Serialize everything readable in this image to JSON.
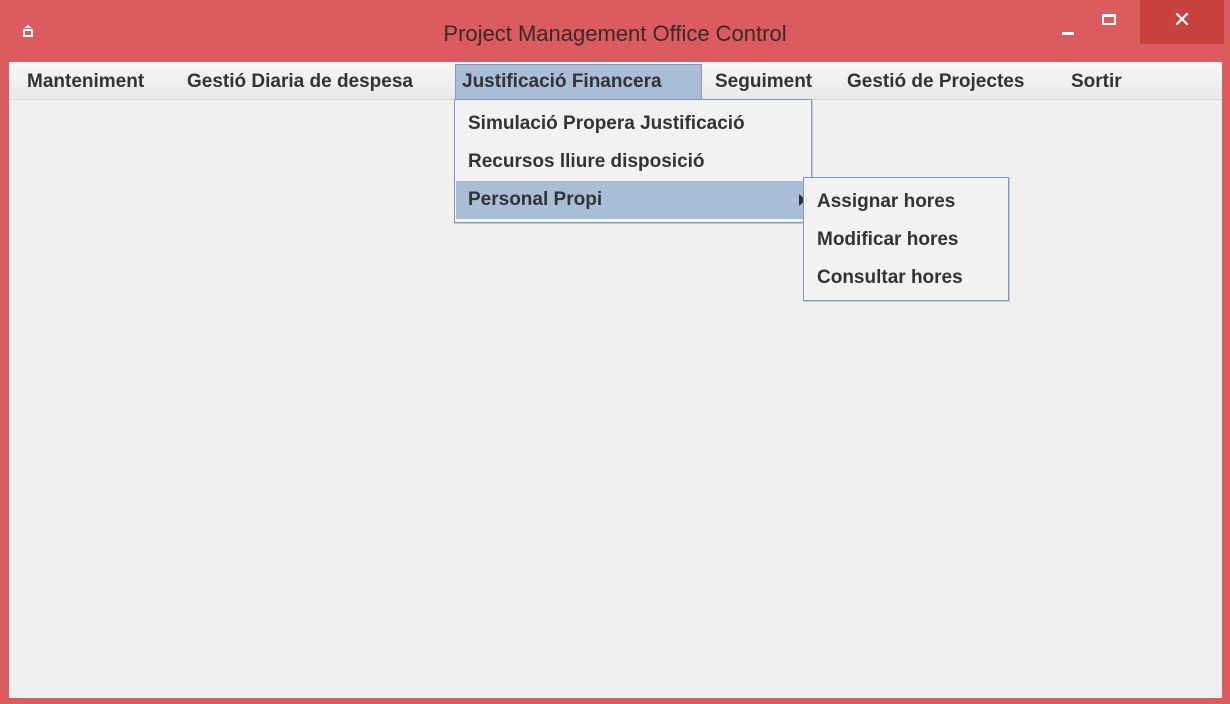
{
  "window": {
    "title": "Project Management Office Control",
    "icon": "java-cup-icon",
    "minimize_icon": "minimize-icon",
    "maximize_icon": "maximize-icon",
    "close_icon": "close-icon",
    "close_glyph": "✕"
  },
  "menubar": {
    "items": [
      {
        "label": "Manteniment"
      },
      {
        "label": "Gestió Diaria de despesa"
      },
      {
        "label": "Justificació Financera"
      },
      {
        "label": "Seguiment"
      },
      {
        "label": "Gestió de Projectes"
      },
      {
        "label": "Sortir"
      }
    ],
    "active_index": 2
  },
  "justificacio_menu": {
    "items": [
      {
        "label": "Simulació Propera Justificació"
      },
      {
        "label": "Recursos lliure disposició"
      },
      {
        "label": "Personal Propi",
        "has_submenu": true
      }
    ],
    "selected_index": 2
  },
  "personal_submenu": {
    "items": [
      {
        "label": "Assignar hores"
      },
      {
        "label": "Modificar hores"
      },
      {
        "label": "Consultar hores"
      }
    ]
  },
  "colors": {
    "title_bar": "#dc5b5e",
    "close_button": "#c9403f",
    "menu_highlight": "#a9bed6",
    "popup_border": "#7c98c3",
    "client_background": "#efefef"
  }
}
